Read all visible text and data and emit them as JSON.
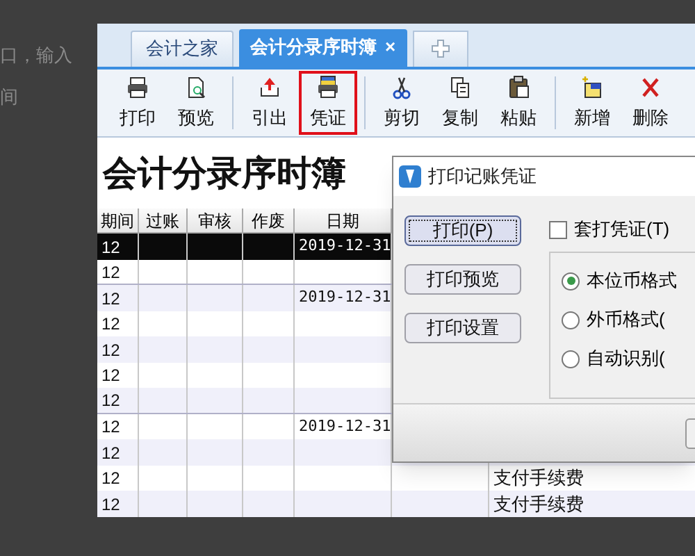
{
  "background_text": [
    "口，输入",
    "间"
  ],
  "tabs": [
    {
      "label": "会计之家",
      "selected": false
    },
    {
      "label": "会计分录序时簿",
      "selected": true,
      "close": "×"
    }
  ],
  "toolbar": [
    {
      "label": "打印",
      "highlighted": false
    },
    {
      "label": "预览",
      "highlighted": false
    },
    {
      "label": "引出",
      "highlighted": false
    },
    {
      "label": "凭证",
      "highlighted": true
    },
    {
      "label": "剪切",
      "highlighted": false
    },
    {
      "label": "复制",
      "highlighted": false
    },
    {
      "label": "粘贴",
      "highlighted": false
    },
    {
      "label": "新增",
      "highlighted": false
    },
    {
      "label": "删除",
      "highlighted": false
    }
  ],
  "page_title": "会计分录序时簿",
  "table": {
    "columns": [
      "期间",
      "过账",
      "审核",
      "作废",
      "日期"
    ],
    "rows": [
      {
        "period": "12",
        "date": "2019-12-31",
        "selected": true
      },
      {
        "period": "12",
        "selected": false
      },
      {
        "period": "12",
        "date": "2019-12-31",
        "selected": false
      },
      {
        "period": "12",
        "selected": false
      },
      {
        "period": "12",
        "selected": false
      },
      {
        "period": "12",
        "selected": false
      },
      {
        "period": "12",
        "selected": false
      },
      {
        "period": "12",
        "date": "2019-12-31",
        "selected": false
      },
      {
        "period": "12",
        "selected": false
      },
      {
        "period": "12",
        "summary": "支付手续费",
        "selected": false
      },
      {
        "period": "12",
        "summary": "支付手续费",
        "selected": false
      }
    ]
  },
  "dialog": {
    "title": "打印记账凭证",
    "buttons": [
      {
        "label": "打印(P)",
        "focused": true
      },
      {
        "label": "打印预览",
        "focused": false
      },
      {
        "label": "打印设置",
        "focused": false
      }
    ],
    "checkbox": {
      "label": "套打凭证(T)",
      "checked": false
    },
    "radios": [
      {
        "label": "本位币格式",
        "selected": true
      },
      {
        "label": "外币格式(",
        "selected": false
      },
      {
        "label": "自动识别(",
        "selected": false
      }
    ]
  }
}
